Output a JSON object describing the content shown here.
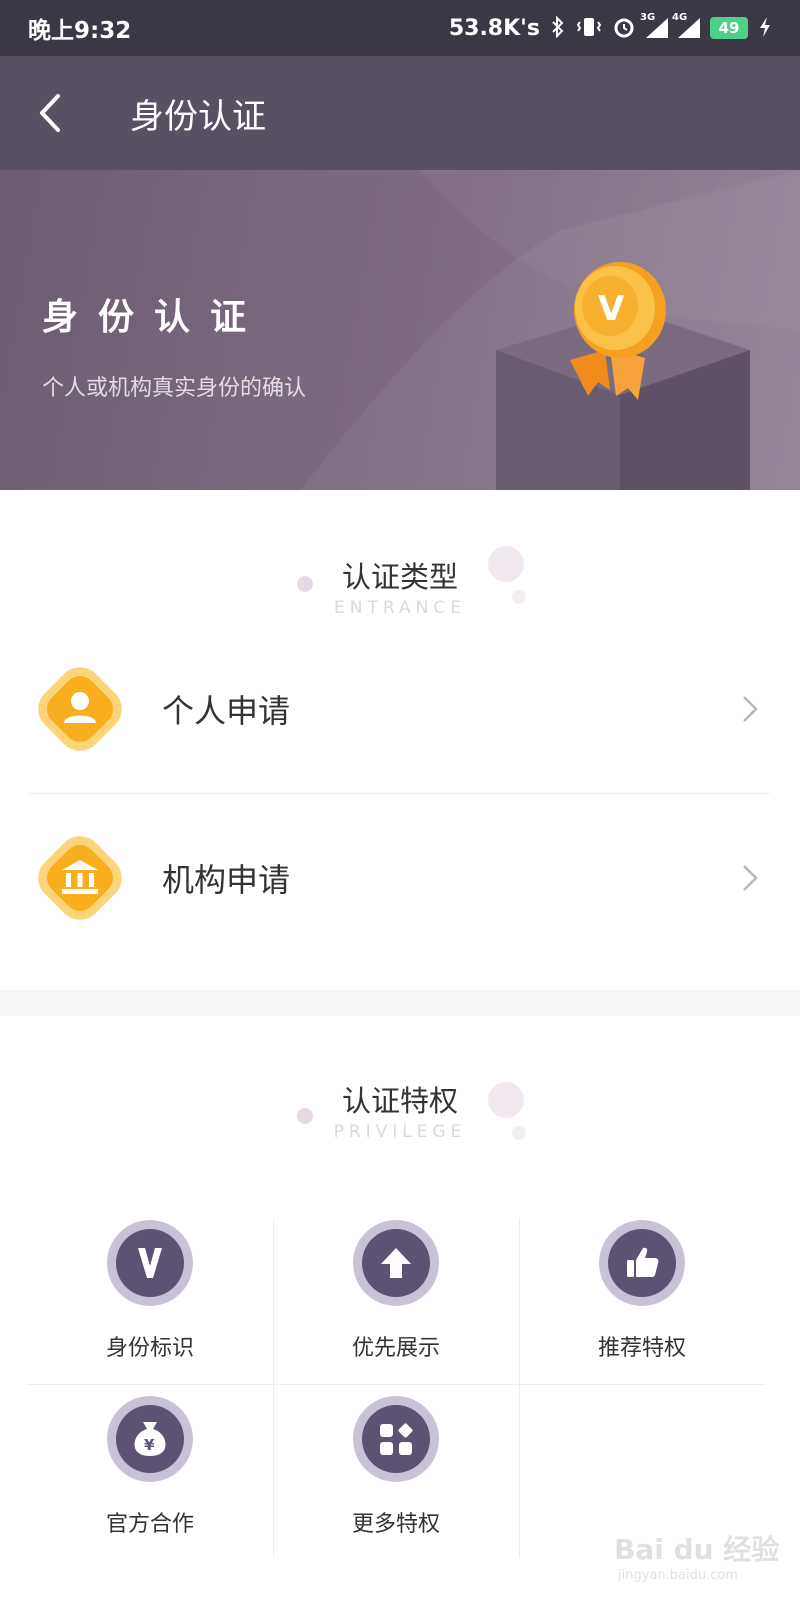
{
  "status_bar": {
    "time": "晚上9:32",
    "speed": "53.8K's",
    "net1": "3G",
    "net2": "4G",
    "battery": "49"
  },
  "nav": {
    "title": "身份认证"
  },
  "banner": {
    "title": "身份认证",
    "subtitle": "个人或机构真实身份的确认",
    "badge_letter": "V"
  },
  "section_types": {
    "title": "认证类型",
    "subtitle": "ENTRANCE"
  },
  "apply_items": [
    {
      "label": "个人申请",
      "icon": "user-icon"
    },
    {
      "label": "机构申请",
      "icon": "institution-icon"
    }
  ],
  "section_privileges": {
    "title": "认证特权",
    "subtitle": "PRIVILEGE"
  },
  "privileges": [
    {
      "label": "身份标识",
      "icon": "v-badge-icon"
    },
    {
      "label": "优先展示",
      "icon": "arrow-up-icon"
    },
    {
      "label": "推荐特权",
      "icon": "thumbs-up-icon"
    },
    {
      "label": "官方合作",
      "icon": "money-bag-icon"
    },
    {
      "label": "更多特权",
      "icon": "more-apps-icon"
    }
  ],
  "colors": {
    "nav_bg": "#5a5063",
    "status_bg": "#3c3744",
    "accent_orange": "#f9a825",
    "privilege_purple": "#5d5272"
  },
  "watermark": {
    "text": "Bai du 经验",
    "url": "jingyan.baidu.com"
  }
}
